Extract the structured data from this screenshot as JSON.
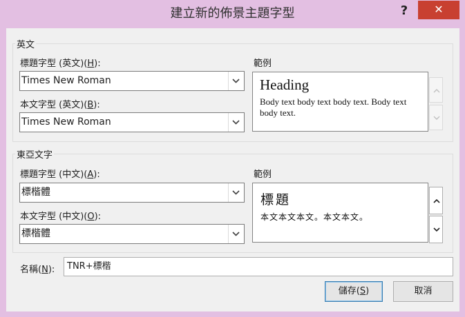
{
  "window": {
    "title": "建立新的佈景主題字型",
    "help_glyph": "?",
    "close_glyph": "✕"
  },
  "latin": {
    "group_label": "英文",
    "heading_font_label": "標題字型 (英文)(",
    "heading_font_key": "H",
    "heading_font_suffix": "):",
    "heading_font_value": "Times New Roman",
    "body_font_label": "本文字型 (英文)(",
    "body_font_key": "B",
    "body_font_suffix": "):",
    "body_font_value": "Times New Roman",
    "sample_label": "範例",
    "sample_heading": "Heading",
    "sample_body": "Body text body text body text. Body text body text."
  },
  "east_asian": {
    "group_label": "東亞文字",
    "heading_font_label": "標題字型 (中文)(",
    "heading_font_key": "A",
    "heading_font_suffix": "):",
    "heading_font_value": "標楷體",
    "body_font_label": "本文字型 (中文)(",
    "body_font_key": "O",
    "body_font_suffix": "):",
    "body_font_value": "標楷體",
    "sample_label": "範例",
    "sample_heading": "標題",
    "sample_body": "本文本文本文。本文本文。"
  },
  "name": {
    "label": "名稱(",
    "key": "N",
    "suffix": "):",
    "value": "TNR+標楷"
  },
  "buttons": {
    "save_label": "儲存(",
    "save_key": "S",
    "save_suffix": ")",
    "cancel_label": "取消"
  }
}
